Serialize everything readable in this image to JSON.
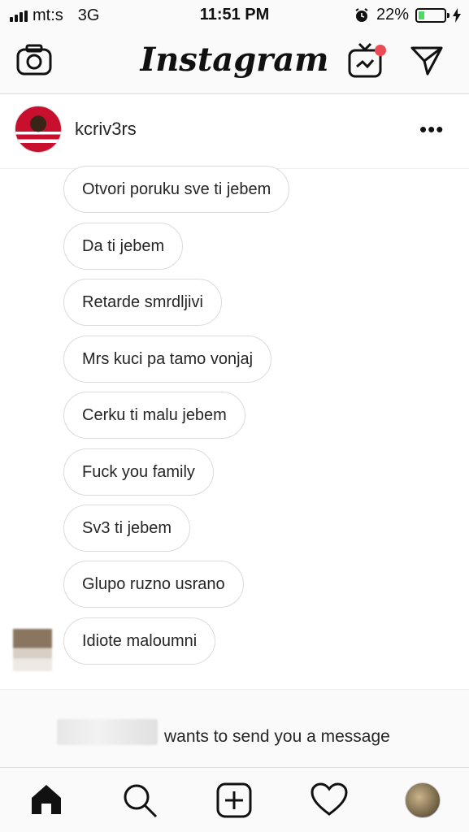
{
  "status": {
    "carrier": "mt:s",
    "network": "3G",
    "time": "11:51 PM",
    "battery_percent": "22%",
    "battery_level": 0.22,
    "icons": [
      "signal-bars-icon",
      "alarm-icon",
      "battery-icon",
      "charging-bolt-icon"
    ]
  },
  "nav": {
    "logo": "Instagram",
    "icons": [
      "camera-icon",
      "igtv-icon",
      "direct-message-icon"
    ],
    "notification_color": "#ed4956"
  },
  "thread": {
    "username": "kcriv3rs",
    "more_label": "•••"
  },
  "messages": [
    {
      "text": "Otvori poruku sve ti jebem"
    },
    {
      "text": "Da ti jebem"
    },
    {
      "text": "Retarde smrdljivi"
    },
    {
      "text": "Mrs kuci pa tamo vonjaj"
    },
    {
      "text": "Cerku ti malu jebem"
    },
    {
      "text": "Fuck you family"
    },
    {
      "text": "Sv3 ti jebem"
    },
    {
      "text": "Glupo ruzno usrano"
    },
    {
      "text": "Idiote maloumni"
    }
  ],
  "request": {
    "text": "wants to send you a message"
  },
  "tabs": [
    "home-icon",
    "search-icon",
    "new-post-icon",
    "activity-heart-icon",
    "profile-avatar"
  ]
}
